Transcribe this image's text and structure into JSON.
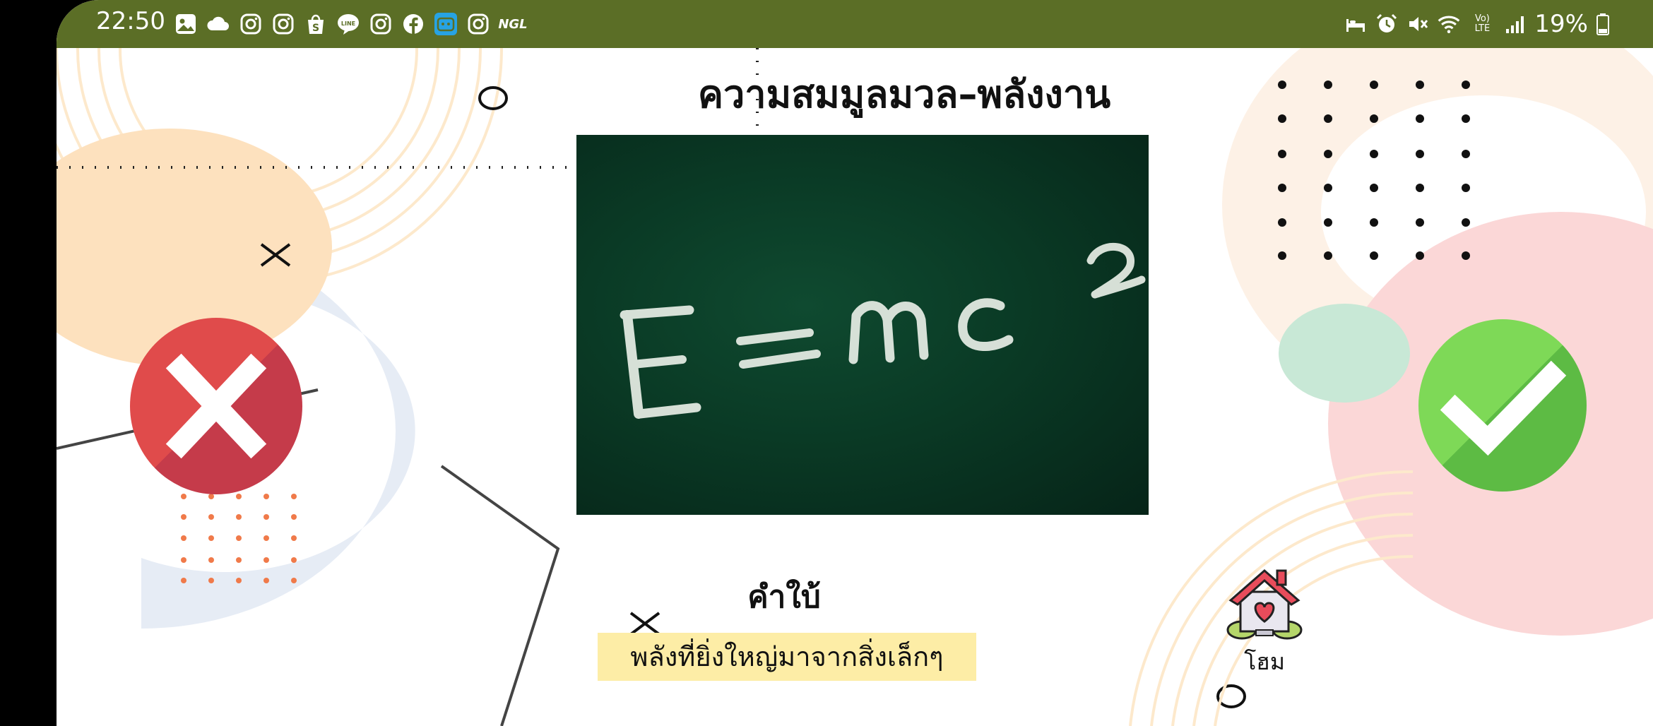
{
  "status_bar": {
    "time": "22:50",
    "battery": "19%",
    "notification_icons": [
      "gallery-icon",
      "cloud-icon",
      "instagram-icon",
      "instagram-icon",
      "shopee-icon",
      "line-icon",
      "instagram-icon",
      "facebook-icon",
      "app-icon",
      "instagram-icon",
      "ngl-icon"
    ],
    "ngl_label": "NGL",
    "line_label": "LINE",
    "volte_label": "Vo) LTE"
  },
  "quiz": {
    "title": "ความสมมูลมวล–พลังงาน",
    "image_equation": "E = mc²",
    "answer_label": "คำใบ้",
    "answer_text": "พลังที่ยิ่งใหญ่มาจากสิ่งเล็กๆ"
  },
  "nav": {
    "home_label": "โฮม"
  },
  "colors": {
    "status_bar": "#5b6e26",
    "wrong": "#e04b4b",
    "correct": "#7ed957",
    "highlight": "#fdeda6",
    "chalkboard": "#0a3a25"
  }
}
